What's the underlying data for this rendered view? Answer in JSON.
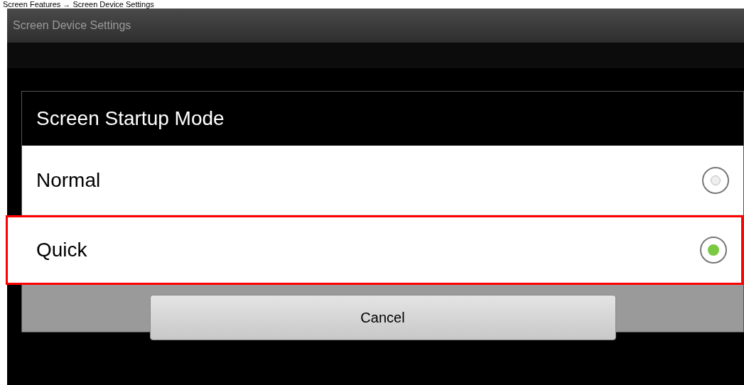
{
  "caption": "Screen Features → Screen Device Settings",
  "window": {
    "title": "Screen Device Settings"
  },
  "dialog": {
    "title": "Screen Startup Mode",
    "options": [
      {
        "label": "Normal",
        "selected": false,
        "highlighted": false
      },
      {
        "label": "Quick",
        "selected": true,
        "highlighted": true
      }
    ],
    "cancel_button": "Cancel"
  }
}
